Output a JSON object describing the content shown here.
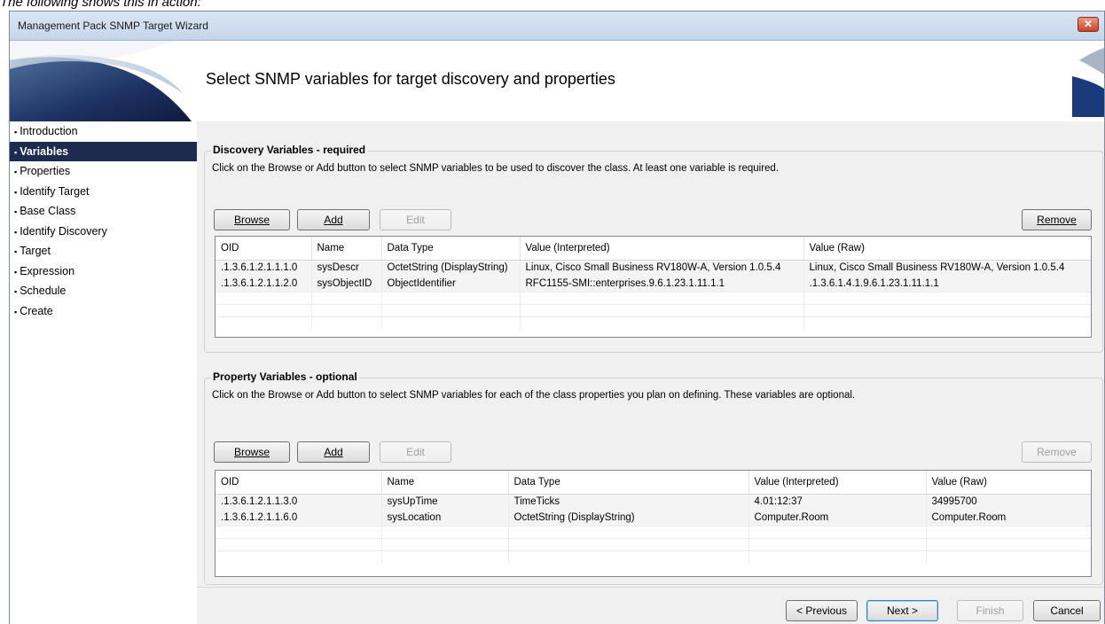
{
  "caption": "The following shows this in action:",
  "window": {
    "title": "Management Pack SNMP Target Wizard",
    "close_glyph": "✕"
  },
  "header": {
    "title": "Select SNMP variables for target discovery and properties"
  },
  "nav": [
    "Introduction",
    "Variables",
    "Properties",
    "Identify Target",
    "Base Class",
    "Identify Discovery",
    "Target",
    "Expression",
    "Schedule",
    "Create"
  ],
  "nav_bullet": "▪",
  "active_nav_index": 1,
  "discovery": {
    "label": "Discovery Variables - required",
    "description": "Click on the Browse or Add button to select SNMP variables to be used to discover the class. At least one variable is required.",
    "buttons": {
      "browse": "Browse",
      "add": "Add",
      "edit": "Edit",
      "remove": "Remove"
    },
    "columns": [
      "OID",
      "Name",
      "Data Type",
      "Value (Interpreted)",
      "Value (Raw)"
    ],
    "rows": [
      [
        ".1.3.6.1.2.1.1.1.0",
        "sysDescr",
        "OctetString (DisplayString)",
        "Linux, Cisco Small Business RV180W-A, Version 1.0.5.4",
        "Linux, Cisco Small Business RV180W-A, Version 1.0.5.4"
      ],
      [
        ".1.3.6.1.2.1.1.2.0",
        "sysObjectID",
        "ObjectIdentifier",
        "RFC1155-SMI::enterprises.9.6.1.23.1.11.1.1",
        ".1.3.6.1.4.1.9.6.1.23.1.11.1.1"
      ]
    ]
  },
  "property": {
    "label": "Property Variables - optional",
    "description": "Click on the Browse or Add button to select SNMP variables for each of the class properties you plan on defining. These variables are optional.",
    "buttons": {
      "browse": "Browse",
      "add": "Add",
      "edit": "Edit",
      "remove": "Remove"
    },
    "columns": [
      "OID",
      "Name",
      "Data Type",
      "Value (Interpreted)",
      "Value (Raw)"
    ],
    "rows": [
      [
        ".1.3.6.1.2.1.1.3.0",
        "sysUpTime",
        "TimeTicks",
        "4.01:12:37",
        "34995700"
      ],
      [
        ".1.3.6.1.2.1.1.6.0",
        "sysLocation",
        "OctetString (DisplayString)",
        "Computer.Room",
        "Computer.Room"
      ]
    ]
  },
  "footer": {
    "previous": "< Previous",
    "next": "Next >",
    "finish": "Finish",
    "cancel": "Cancel"
  },
  "colors": {
    "nav_active_bg": "#1c2b4e",
    "title_bar": "#c4d5ea",
    "close_button": "#c8452a"
  }
}
